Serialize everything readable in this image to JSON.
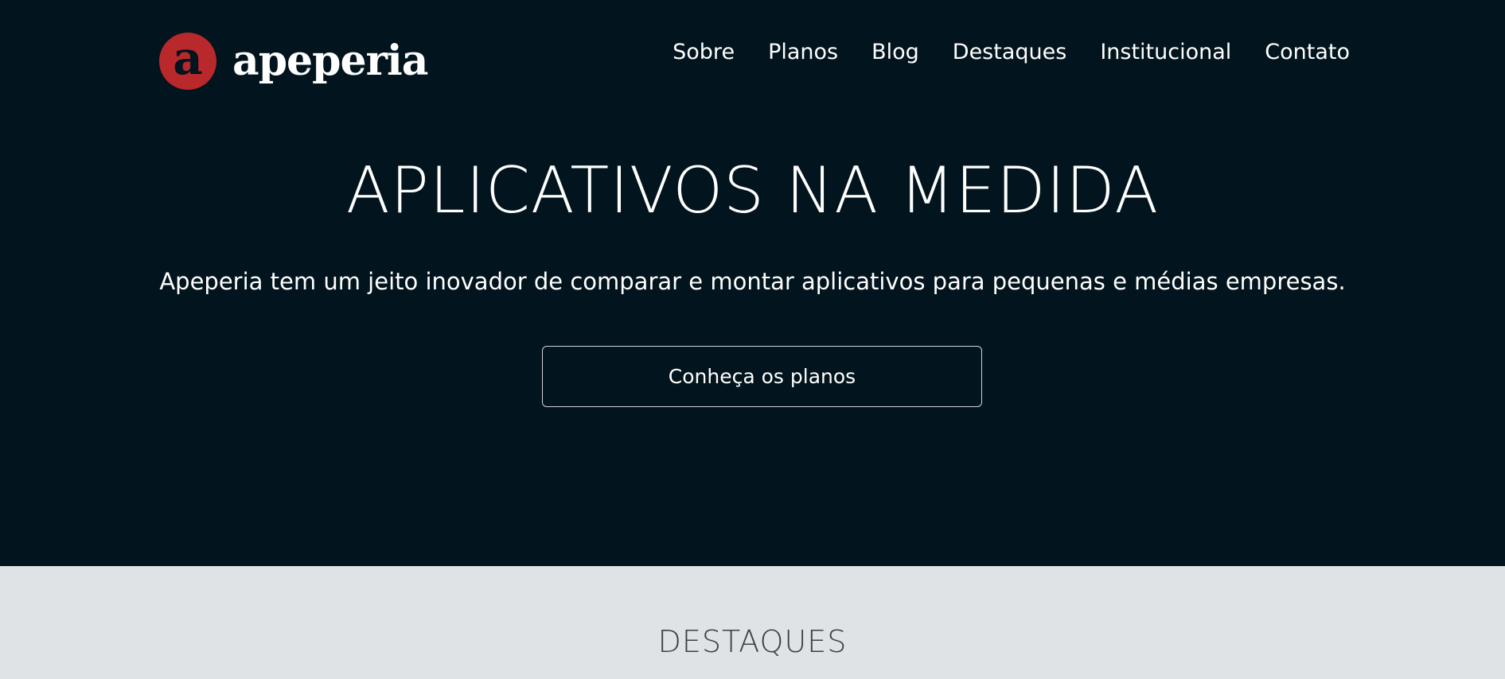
{
  "brand": {
    "mark": "a",
    "name": "apeperia",
    "color": "#b9282a"
  },
  "nav": {
    "items": [
      "Sobre",
      "Planos",
      "Blog",
      "Destaques",
      "Institucional",
      "Contato"
    ]
  },
  "hero": {
    "title": "APLICATIVOS NA MEDIDA",
    "subtitle": "Apeperia tem um jeito inovador de comparar e montar aplicativos para pequenas e médias empresas.",
    "cta_label": "Conheça os planos",
    "background": "#02141d"
  },
  "section": {
    "title": "DESTAQUES",
    "background": "#e0e3e6"
  }
}
